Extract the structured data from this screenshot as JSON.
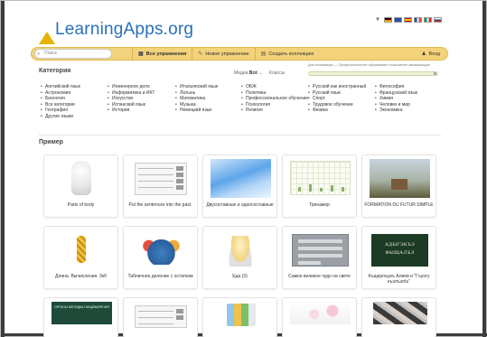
{
  "logo": {
    "text": "LearningApps.org"
  },
  "flags": [
    "Deutsch",
    "English",
    "Español",
    "Français",
    "Italiano",
    "Русский"
  ],
  "topbar": {
    "search_placeholder": "Поиск",
    "all_exercises": "Все упражнения",
    "new_exercise": "Новое упражнение",
    "create_collection": "Создать коллекцию",
    "login": "Вход"
  },
  "filters": {
    "category_title": "Категория",
    "media_label": "Медиа",
    "media_value": "Всё",
    "classes_label": "Классы",
    "level_text": "Для начинающих — Профессиональное образование и повышение квалификации"
  },
  "categories": [
    [
      "Английский язык",
      "Астрономия",
      "Биология",
      "Все категории",
      "География",
      "Другие языки"
    ],
    [
      "Инженерное дело",
      "Информатика и ИКТ",
      "Искусство",
      "Испанский язык",
      "История"
    ],
    [
      "Итальянский язык",
      "Латынь",
      "Математика",
      "Музыка",
      "Немецкий язык"
    ],
    [
      "ОБЖ",
      "Политика",
      "Профессиональное обучение",
      "Психология",
      "Религия"
    ],
    [
      "Русский как иностранный",
      "Русский язык",
      "Спорт",
      "Трудовое обучение",
      "Физика"
    ],
    [
      "Философия",
      "Французский язык",
      "Химия",
      "Человек и мир",
      "Экономика"
    ]
  ],
  "example_title": "Пример",
  "cards": [
    {
      "label": "Parts of body",
      "thumb": "tooth"
    },
    {
      "label": "Put the sentences into the past.",
      "thumb": "worksheet"
    },
    {
      "label": "Двусоставные и односоставные",
      "thumb": "blue-wave"
    },
    {
      "label": "Тренажер",
      "thumb": "grid"
    },
    {
      "label": "FORMATION DU FUTUR SIMPLE",
      "thumb": "landscape"
    },
    {
      "label": "Длина. Вычисления. 3кб",
      "thumb": "giraffe"
    },
    {
      "label": "Табличное деление с остатком",
      "thumb": "tablet"
    },
    {
      "label": "Еда (3)",
      "thumb": "bowl"
    },
    {
      "label": "Самое великое чудо на свете",
      "thumb": "form"
    },
    {
      "label": "Къщерлъукъ Алиев и \"Гъуогу къэлъэпlъ\"",
      "thumb": "board",
      "board_text": "АДЫГЭКЪЭ\nФЫЩАЛЪЭ"
    },
    {
      "label": "",
      "thumb": "greenboard",
      "board_text": "ОРГАНЫ ЖЕЛУДКА ПИЩЕВАРЕНИЯ"
    },
    {
      "label": "",
      "thumb": "worksheet2"
    },
    {
      "label": "",
      "thumb": "bottles"
    },
    {
      "label": "",
      "thumb": "flower"
    },
    {
      "label": "",
      "thumb": "collage"
    }
  ],
  "colors": {
    "toolbar": "#f2d27a",
    "logo": "#2a6fb8",
    "frame_dark": "#3c3c3c"
  }
}
